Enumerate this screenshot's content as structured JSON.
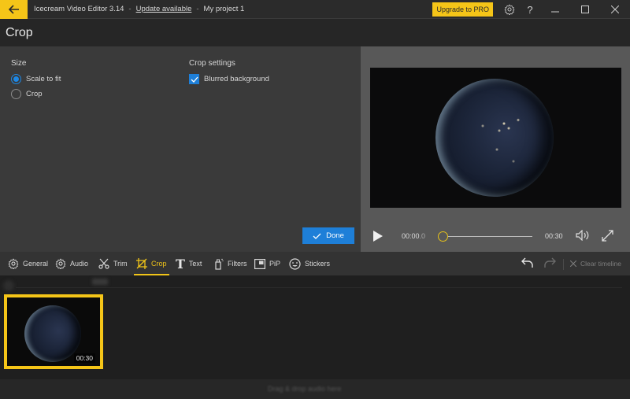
{
  "titlebar": {
    "app_name": "Icecream Video Editor 3.14",
    "separator": "-",
    "update_link": "Update available",
    "project_name": "My project 1",
    "upgrade_label": "Upgrade to PRO"
  },
  "header": {
    "title": "Crop"
  },
  "settings": {
    "size_label": "Size",
    "size_options": [
      {
        "label": "Scale to fit",
        "selected": true
      },
      {
        "label": "Crop",
        "selected": false
      }
    ],
    "crop_settings_label": "Crop settings",
    "blurred_background_label": "Blurred background",
    "blurred_background_checked": true,
    "done_label": "Done"
  },
  "player": {
    "current_time_main": "00:00",
    "current_time_frac": ".0",
    "total_time": "00:30",
    "progress": 0.0
  },
  "toolbar": {
    "tools": [
      {
        "label": "General",
        "icon": "gear-icon"
      },
      {
        "label": "Audio",
        "icon": "gear-icon"
      },
      {
        "label": "Trim",
        "icon": "scissors-icon"
      },
      {
        "label": "Crop",
        "icon": "crop-icon",
        "active": true
      },
      {
        "label": "Text",
        "icon": "text-icon"
      },
      {
        "label": "Filters",
        "icon": "spray-icon"
      },
      {
        "label": "PiP",
        "icon": "pip-icon"
      },
      {
        "label": "Stickers",
        "icon": "smiley-icon"
      }
    ],
    "clear_timeline_label": "Clear timeline"
  },
  "timeline": {
    "clip_duration": "00:30",
    "audio_hint": "Drag & drop audio here"
  },
  "colors": {
    "accent_yellow": "#f5c518",
    "accent_blue": "#1e7fd8"
  }
}
